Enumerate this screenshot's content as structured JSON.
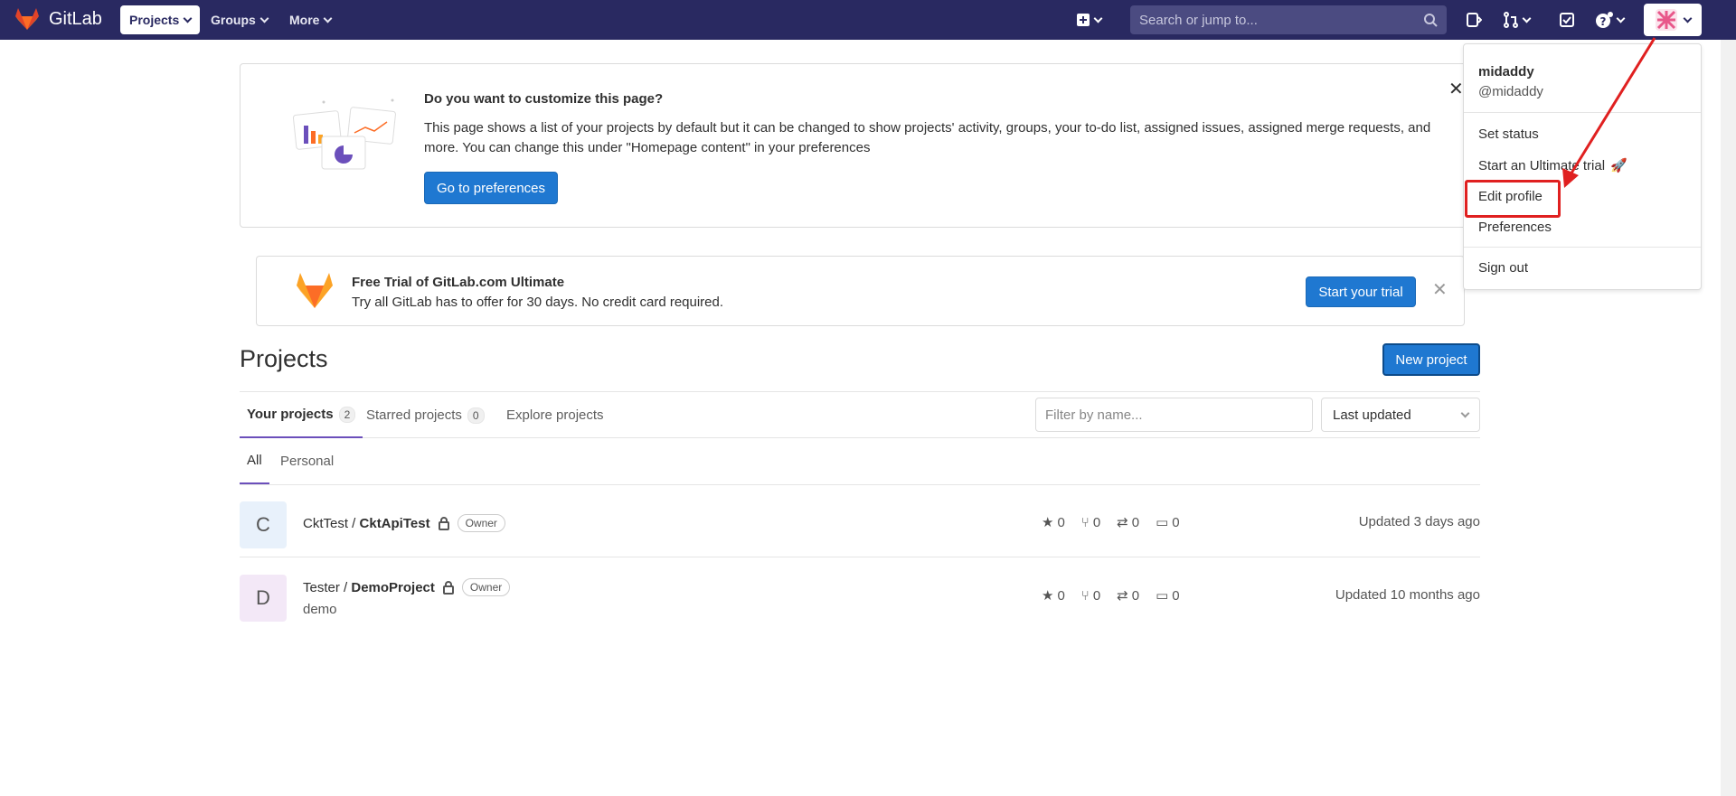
{
  "navbar": {
    "brand": "GitLab",
    "projects_label": "Projects",
    "groups_label": "Groups",
    "more_label": "More",
    "search_placeholder": "Search or jump to..."
  },
  "customize_alert": {
    "title": "Do you want to customize this page?",
    "body": "This page shows a list of your projects by default but it can be changed to show projects' activity, groups, your to-do list, assigned issues, assigned merge requests, and more. You can change this under \"Homepage content\" in your preferences",
    "button": "Go to preferences"
  },
  "trial_alert": {
    "title": "Free Trial of GitLab.com Ultimate",
    "body": "Try all GitLab has to offer for 30 days. No credit card required.",
    "button": "Start your trial"
  },
  "page": {
    "title": "Projects",
    "new_project": "New project"
  },
  "tabs": {
    "your_projects": "Your projects",
    "your_projects_count": "2",
    "starred": "Starred projects",
    "starred_count": "0",
    "explore": "Explore projects",
    "filter_placeholder": "Filter by name...",
    "sort_value": "Last updated"
  },
  "subtabs": {
    "all": "All",
    "personal": "Personal"
  },
  "projects": [
    {
      "letter": "C",
      "namespace": "CktTest / ",
      "name": "CktApiTest",
      "role": "Owner",
      "description": "",
      "stars": "0",
      "forks": "0",
      "mrs": "0",
      "issues": "0",
      "updated": "Updated 3 days ago",
      "avatar_color": "#e8f1fb"
    },
    {
      "letter": "D",
      "namespace": "Tester / ",
      "name": "DemoProject",
      "role": "Owner",
      "description": "demo",
      "stars": "0",
      "forks": "0",
      "mrs": "0",
      "issues": "0",
      "updated": "Updated 10 months ago",
      "avatar_color": "#f3e8f7"
    }
  ],
  "user_menu": {
    "name": "midaddy",
    "handle": "@midaddy",
    "set_status": "Set status",
    "ultimate_trial": "Start an Ultimate trial",
    "edit_profile": "Edit profile",
    "preferences": "Preferences",
    "sign_out": "Sign out"
  },
  "colors": {
    "navbar": "#292961",
    "accent": "#1f78d1",
    "annotation": "#e02020"
  }
}
